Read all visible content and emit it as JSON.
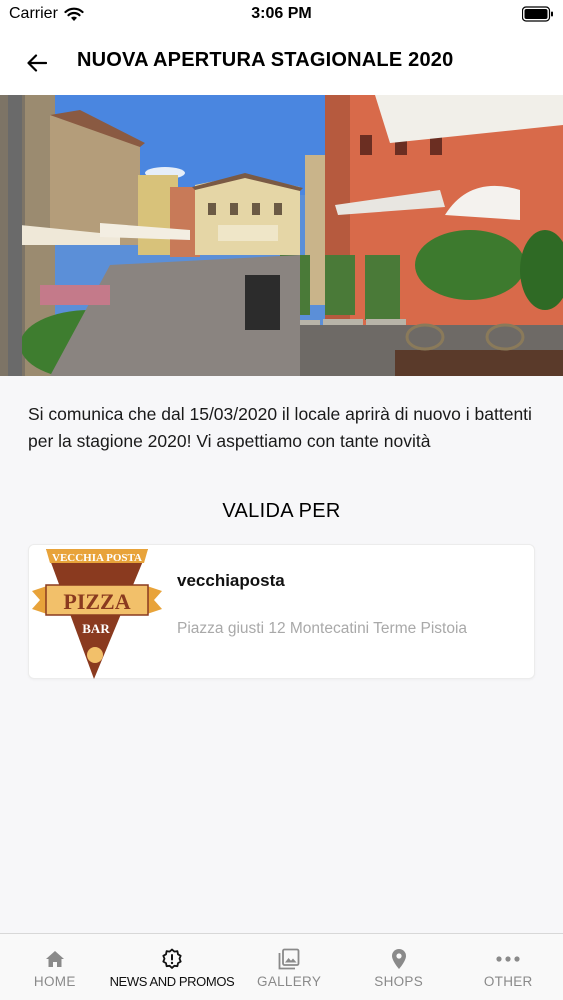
{
  "status_bar": {
    "carrier": "Carrier",
    "time": "3:06 PM"
  },
  "header": {
    "back_icon": "arrow-left-icon",
    "title": "NUOVA APERTURA STAGIONALE 2020"
  },
  "promo": {
    "description": "Si comunica che dal 15/03/2020 il locale aprirà di nuovo i battenti per la stagione 2020! Vi aspettiamo con tante novità",
    "valid_for_heading": "VALIDA PER"
  },
  "shop": {
    "name": "vecchiaposta",
    "address": "Piazza giusti 12 Montecatini Terme Pistoia",
    "logo": {
      "line1": "VECCHIA POSTA",
      "line2": "PIZZA",
      "line3": "BAR"
    }
  },
  "tab_bar": {
    "tabs": [
      {
        "label": "HOME",
        "icon": "home-icon",
        "active": false
      },
      {
        "label": "NEWS AND PROMOS",
        "icon": "alert-badge-icon",
        "active": true
      },
      {
        "label": "GALLERY",
        "icon": "gallery-icon",
        "active": false
      },
      {
        "label": "SHOPS",
        "icon": "map-pin-icon",
        "active": false
      },
      {
        "label": "OTHER",
        "icon": "more-dots-icon",
        "active": false
      }
    ]
  },
  "colors": {
    "accent": "#000000",
    "inactive_tab": "#8a8a8a",
    "address_gray": "#a9a9a9",
    "logo_orange": "#e8a33a",
    "logo_brown": "#8a3a1f"
  }
}
